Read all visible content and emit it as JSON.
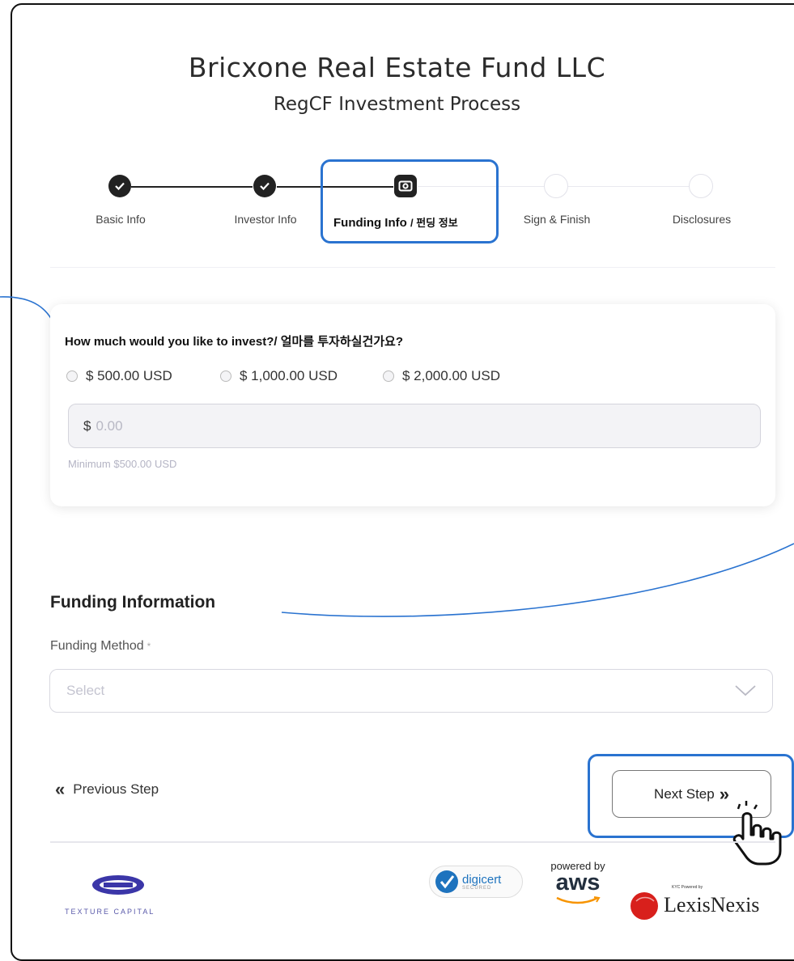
{
  "header": {
    "title": "Bricxone Real Estate Fund LLC",
    "subtitle": "RegCF Investment Process"
  },
  "steps": [
    {
      "label": "Basic Info",
      "state": "done"
    },
    {
      "label": "Investor Info",
      "state": "done"
    },
    {
      "label": "Funding Info",
      "label_extra": "/ 펀딩 정보",
      "state": "current"
    },
    {
      "label": "Sign & Finish",
      "state": "pending"
    },
    {
      "label": "Disclosures",
      "state": "pending"
    }
  ],
  "investment": {
    "question": "How much would you like to invest?/ 얼마를 투자하실건가요?",
    "options": [
      "$ 500.00 USD",
      "$ 1,000.00 USD",
      "$ 2,000.00 USD"
    ],
    "currency_symbol": "$",
    "amount_placeholder": "0.00",
    "hint": "Minimum $500.00 USD"
  },
  "funding": {
    "section_title": "Funding Information",
    "method_label": "Funding Method",
    "required_mark": "*",
    "select_placeholder": "Select"
  },
  "nav": {
    "previous_label": "Previous Step",
    "next_label": "Next Step"
  },
  "footer": {
    "brand_text": "TEXTURE CAPITAL",
    "digicert_label": "digicert",
    "digicert_sub": "SECURED",
    "aws_top": "powered by",
    "aws_main": "aws",
    "lexis_small": "KYC Powered by",
    "lexis_main": "LexisNexis"
  },
  "colors": {
    "highlight": "#2a73d0",
    "step_done": "#222222",
    "lexis_red": "#d8201c",
    "digicert_blue": "#1e73be",
    "aws_orange": "#f79400",
    "texture_blue": "#3b36a8"
  }
}
